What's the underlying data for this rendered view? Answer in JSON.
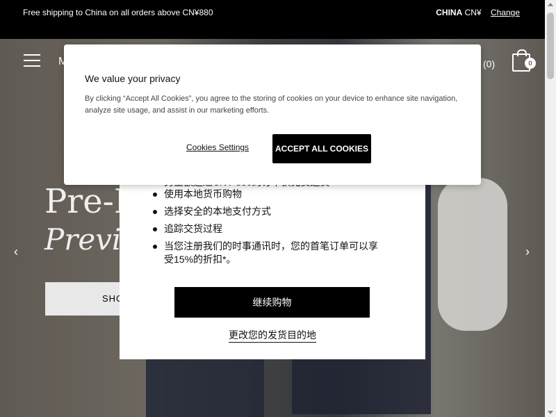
{
  "topbar": {
    "shipping_text": "Free shipping to China on all orders above CN¥880",
    "country": "CHINA",
    "currency": "CN¥",
    "change_label": "Change"
  },
  "nav": {
    "logo_partial": "M",
    "bag_count_text": "(0)",
    "bag_badge": "0"
  },
  "hero": {
    "title_line1": "Pre-F",
    "title_line2": "Previe",
    "shop_button_partial": "SHO",
    "prev_arrow": "‹",
    "next_arrow": "›"
  },
  "ship_modal": {
    "partial_first_line": "另金额超过CNY 880的订单获免费送货",
    "bullets": [
      "使用本地货币购物",
      "选择安全的本地支付方式",
      "追踪交货过程",
      "当您注册我们的时事通讯时，您的首笔订单可以享受15%的折扣*。"
    ],
    "continue_label": "继续购物",
    "change_destination_label": "更改您的发货目的地"
  },
  "cookie_banner": {
    "title": "We value your privacy",
    "body": "By clicking “Accept All Cookies”, you agree to the storing of cookies on your device to enhance site navigation, analyze site usage, and assist in our marketing efforts.",
    "settings_label": "Cookies Settings",
    "accept_label": "ACCEPT ALL COOKIES"
  }
}
